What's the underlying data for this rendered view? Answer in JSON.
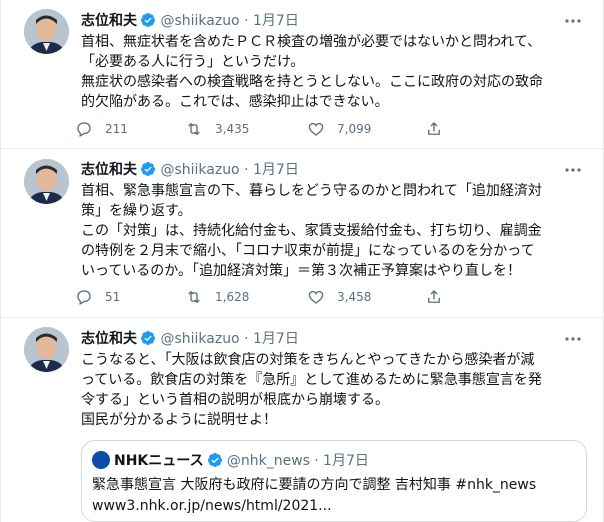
{
  "colors": {
    "accent": "#1d9bf0",
    "muted": "#5b7083",
    "border": "#e6ecf0"
  },
  "tweets": [
    {
      "name": "志位和夫",
      "handle": "@shiikazuo",
      "dot": "·",
      "date": "1月7日",
      "text": "首相、無症状者を含めたＰＣＲ検査の増強が必要ではないかと問われて、\n「必要ある人に行う」というだけ。\n無症状の感染者への検査戦略を持とうとしない。ここに政府の対応の致命\n的欠陥がある。これでは、感染抑止はできない。",
      "replies": "211",
      "retweets": "3,435",
      "likes": "7,099"
    },
    {
      "name": "志位和夫",
      "handle": "@shiikazuo",
      "dot": "·",
      "date": "1月7日",
      "text": "首相、緊急事態宣言の下、暮らしをどう守るのかと問われて「追加経済対\n策」を繰り返す。\nこの「対策」は、持続化給付金も、家賃支援給付金も、打ち切り、雇調金\nの特例を２月末で縮小、「コロナ収束が前提」になっているのを分かって\nいっているのか。「追加経済対策」＝第３次補正予算案はやり直しを！",
      "replies": "51",
      "retweets": "1,628",
      "likes": "3,458"
    },
    {
      "name": "志位和夫",
      "handle": "@shiikazuo",
      "dot": "·",
      "date": "1月7日",
      "text": "こうなると、「大阪は飲食店の対策をきちんとやってきたから感染者が減\nっている。飲食店の対策を『急所』として進めるために緊急事態宣言を発\n令する」という首相の説明が根底から崩壊する。\n国民が分かるように説明せよ！",
      "quote": {
        "name": "NHKニュース",
        "handle": "@nhk_news",
        "dot": "·",
        "date": "1月7日",
        "text": "緊急事態宣言 大阪府も政府に要請の方向で調整 吉村知事 #nhk_news\nwww3.nhk.or.jp/news/html/2021..."
      }
    }
  ]
}
